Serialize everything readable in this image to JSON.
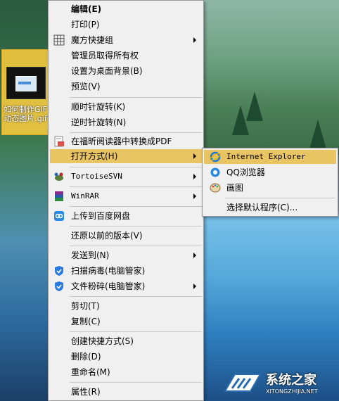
{
  "desktop": {
    "file_label": "如何制作GIF动态图片.gif"
  },
  "context_menu": {
    "items": [
      {
        "label": "编辑(E)"
      },
      {
        "label": "打印(P)"
      },
      {
        "label": "魔方快捷组"
      },
      {
        "label": "管理员取得所有权"
      },
      {
        "label": "设置为桌面背景(B)"
      },
      {
        "label": "预览(V)"
      },
      {
        "label": "顺时针旋转(K)"
      },
      {
        "label": "逆时针旋转(N)"
      },
      {
        "label": "在福昕阅读器中转换成PDF"
      },
      {
        "label": "打开方式(H)"
      },
      {
        "label": "TortoiseSVN"
      },
      {
        "label": "WinRAR"
      },
      {
        "label": "上传到百度网盘"
      },
      {
        "label": "还原以前的版本(V)"
      },
      {
        "label": "发送到(N)"
      },
      {
        "label": "扫描病毒(电脑管家)"
      },
      {
        "label": "文件粉碎(电脑管家)"
      },
      {
        "label": "剪切(T)"
      },
      {
        "label": "复制(C)"
      },
      {
        "label": "创建快捷方式(S)"
      },
      {
        "label": "删除(D)"
      },
      {
        "label": "重命名(M)"
      },
      {
        "label": "属性(R)"
      }
    ]
  },
  "open_with_submenu": {
    "items": [
      {
        "label": "Internet Explorer"
      },
      {
        "label": "QQ浏览器"
      },
      {
        "label": "画图"
      },
      {
        "label": "选择默认程序(C)..."
      }
    ]
  },
  "watermark": {
    "title": "系统之家",
    "subtitle": "XITONGZHIJIA.NET"
  },
  "colors": {
    "menu_bg": "#f0f0f0",
    "highlight": "#e8c463",
    "border": "#979797"
  }
}
